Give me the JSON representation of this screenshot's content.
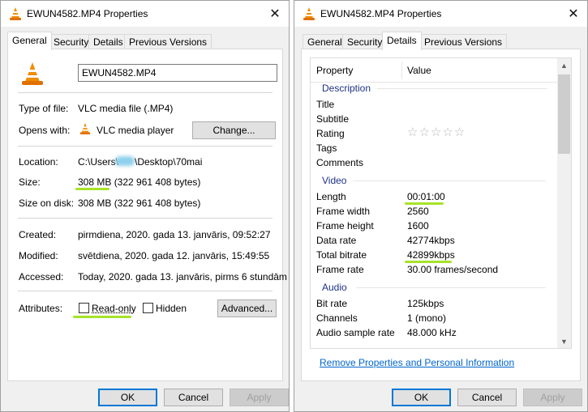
{
  "window_title": "EWUN4582.MP4 Properties",
  "close_glyph": "✕",
  "tabs_left": [
    "General",
    "Security",
    "Details",
    "Previous Versions"
  ],
  "tabs_right": [
    "General",
    "Security",
    "Details",
    "Previous Versions"
  ],
  "general": {
    "file_name": "EWUN4582.MP4",
    "type_label": "Type of file:",
    "type_value": "VLC media file (.MP4)",
    "opens_label": "Opens with:",
    "opens_value": "VLC media player",
    "change_button": "Change...",
    "location_label": "Location:",
    "location_prefix": "C:\\Users\\",
    "location_suffix": "\\Desktop\\70mai",
    "size_label": "Size:",
    "size_value": "308 MB (322 961 408 bytes)",
    "size_on_disk_label": "Size on disk:",
    "size_on_disk_value": "308 MB (322 961 408 bytes)",
    "created_label": "Created:",
    "created_value": "pirmdiena, 2020. gada 13. janvāris, 09:52:27",
    "modified_label": "Modified:",
    "modified_value": "svētdiena, 2020. gada 12. janvāris, 15:49:55",
    "accessed_label": "Accessed:",
    "accessed_value": "Today, 2020. gada 13. janvāris, pirms 6 stundām",
    "attributes_label": "Attributes:",
    "readonly_label": "Read-only",
    "hidden_label": "Hidden",
    "advanced_button": "Advanced..."
  },
  "details": {
    "col_property": "Property",
    "col_value": "Value",
    "groups": {
      "description": "Description",
      "video": "Video",
      "audio": "Audio"
    },
    "description": {
      "title": "Title",
      "subtitle": "Subtitle",
      "rating": "Rating",
      "tags": "Tags",
      "comments": "Comments",
      "rating_stars": "☆☆☆☆☆"
    },
    "video": {
      "length_label": "Length",
      "length_value": "00:01:00",
      "width_label": "Frame width",
      "width_value": "2560",
      "height_label": "Frame height",
      "height_value": "1600",
      "datarate_label": "Data rate",
      "datarate_value": "42774kbps",
      "bitrate_label": "Total bitrate",
      "bitrate_value": "42899kbps",
      "framerate_label": "Frame rate",
      "framerate_value": "30.00 frames/second"
    },
    "audio": {
      "bitrate_label": "Bit rate",
      "bitrate_value": "125kbps",
      "channels_label": "Channels",
      "channels_value": "1 (mono)",
      "samplerate_label": "Audio sample rate",
      "samplerate_value": "48.000 kHz"
    },
    "remove_link": "Remove Properties and Personal Information"
  },
  "buttons": {
    "ok": "OK",
    "cancel": "Cancel",
    "apply": "Apply"
  },
  "colors": {
    "accent": "#0078d7",
    "highlight": "#a7e329",
    "link": "#0066cc",
    "group": "#1e3287",
    "vlc_orange": "#f08c00"
  }
}
